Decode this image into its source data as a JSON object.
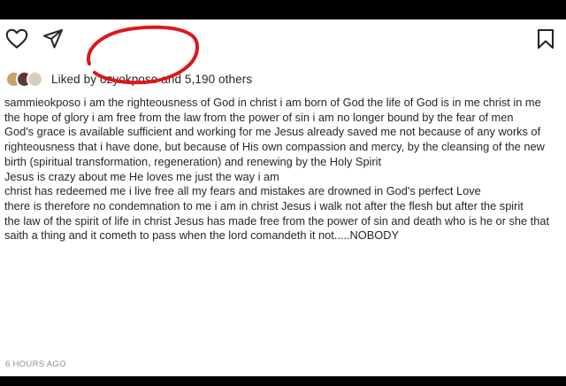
{
  "colors": {
    "annotation": "#e0161b",
    "text": "#262626",
    "muted": "#8e8e8e",
    "avatar_1": "#c9a46a",
    "avatar_2": "#5c3a2e",
    "avatar_3": "#d8cfc2"
  },
  "icons": {
    "like": "heart-icon",
    "share": "send-icon",
    "save": "bookmark-icon"
  },
  "likes": {
    "prefix": "Liked by ",
    "user": "ozyokposo",
    "joiner": " and ",
    "count": "5,190 others"
  },
  "caption_lines": [
    "sammieokposo i am the righteousness of God in christ i am born of God the life of God is in me christ in me the hope of glory i am free from the law from the power of sin i am no longer bound by the fear of men",
    "God's grace is available sufficient and working for me Jesus already saved me not because of any works of righteousness that i have done, but because of His own compassion and mercy, by the cleansing of the new birth (spiritual transformation, regeneration) and renewing by the Holy Spirit",
    "Jesus is crazy about me He loves me just the way i am",
    "christ has redeemed me i live free all my fears and mistakes are drowned in God's perfect Love",
    "there is therefore no condemnation to me i am in christ Jesus i walk not after the flesh but after the spirit",
    "the law of the spirit of life in christ Jesus has made free from the power of sin and death who is he or she that saith a thing and it cometh to pass when the lord comandeth it not.....NOBODY"
  ],
  "timestamp": "6 HOURS AGO"
}
